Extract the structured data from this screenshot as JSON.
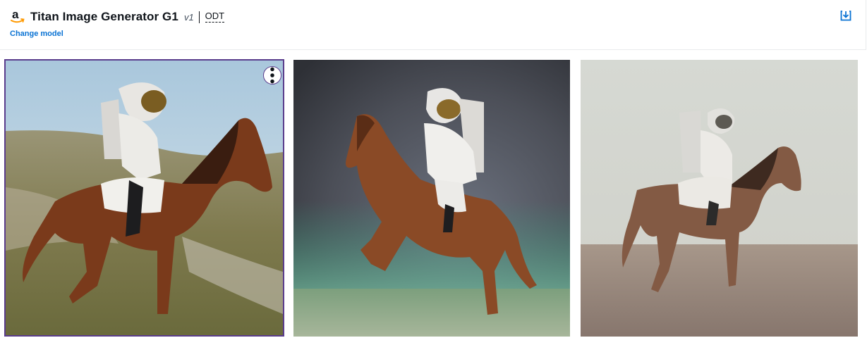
{
  "header": {
    "provider_logo_icon": "amazon-smile-logo",
    "model_name": "Titan Image Generator G1",
    "version": "v1",
    "badge": "ODT",
    "change_model_label": "Change model",
    "download_icon": "download-icon"
  },
  "images": [
    {
      "selected": true,
      "menu_icon": "more-vertical-icon"
    },
    {
      "selected": false
    },
    {
      "selected": false
    }
  ],
  "colors": {
    "link": "#0972d3",
    "selected_border": "#5a3c8c",
    "amazon_orange": "#ff9900"
  }
}
